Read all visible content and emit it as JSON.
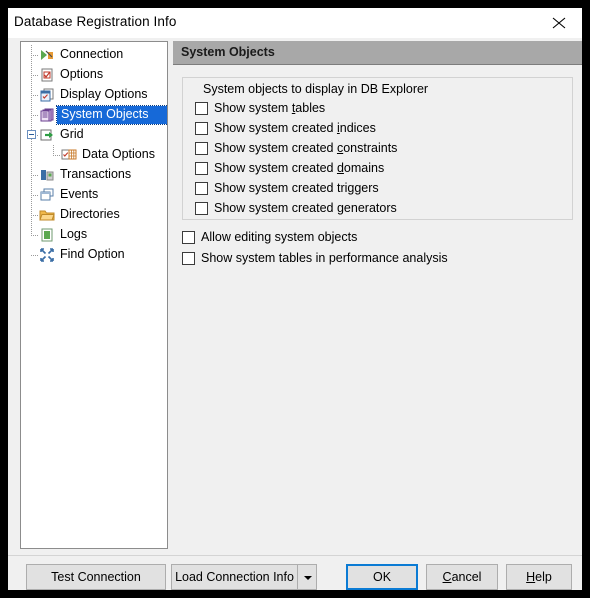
{
  "window": {
    "title": "Database Registration Info",
    "close_icon": "close-icon"
  },
  "sidebar": {
    "items": [
      {
        "label": "Connection",
        "icon": "connection-plug-icon",
        "level": 1,
        "selected": false,
        "expander": null
      },
      {
        "label": "Options",
        "icon": "options-document-icon",
        "level": 1,
        "selected": false,
        "expander": null
      },
      {
        "label": "Display Options",
        "icon": "display-window-icon",
        "level": 1,
        "selected": false,
        "expander": null
      },
      {
        "label": "System Objects",
        "icon": "system-objects-stack-icon",
        "level": 1,
        "selected": true,
        "expander": null
      },
      {
        "label": "Grid",
        "icon": "grid-arrow-icon",
        "level": 1,
        "selected": false,
        "expander": "minus"
      },
      {
        "label": "Data Options",
        "icon": "data-options-grid-icon",
        "level": 2,
        "selected": false,
        "expander": null
      },
      {
        "label": "Transactions",
        "icon": "transactions-icon",
        "level": 1,
        "selected": false,
        "expander": null
      },
      {
        "label": "Events",
        "icon": "events-icon",
        "level": 1,
        "selected": false,
        "expander": null
      },
      {
        "label": "Directories",
        "icon": "folder-icon",
        "level": 1,
        "selected": false,
        "expander": null
      },
      {
        "label": "Logs",
        "icon": "logs-icon",
        "level": 1,
        "selected": false,
        "expander": null
      },
      {
        "label": "Find Option",
        "icon": "find-option-icon",
        "level": 1,
        "selected": false,
        "expander": null
      }
    ]
  },
  "main": {
    "header_title": "System Objects",
    "group": {
      "legend": "System objects to display in DB Explorer",
      "checkboxes": [
        {
          "label": "Show system tables",
          "accel": "t",
          "checked": false
        },
        {
          "label": "Show system created indices",
          "accel": "i",
          "checked": false
        },
        {
          "label": "Show system created constraints",
          "accel": "c",
          "checked": false
        },
        {
          "label": "Show system created domains",
          "accel": "d",
          "checked": false
        },
        {
          "label": "Show system created triggers",
          "accel": "g",
          "checked": false
        },
        {
          "label": "Show system created generators",
          "accel": "g",
          "checked": false
        }
      ]
    },
    "standalone_checkboxes": [
      {
        "label": "Allow editing system objects",
        "accel": "",
        "checked": false
      },
      {
        "label": "Show system tables in performance analysis",
        "accel": "",
        "checked": false
      }
    ]
  },
  "footer": {
    "test_connection": "Test Connection",
    "load_connection_info": "Load Connection Info",
    "dropdown_icon": "chevron-down-icon",
    "ok": "OK",
    "cancel": "Cancel",
    "cancel_accel": "C",
    "help": "Help",
    "help_accel": "H"
  },
  "colors": {
    "selection_blue": "#1669d8",
    "focus_blue": "#0b7bd4",
    "header_gray": "#a8a8a8",
    "panel_bg": "#f0f0f0"
  }
}
